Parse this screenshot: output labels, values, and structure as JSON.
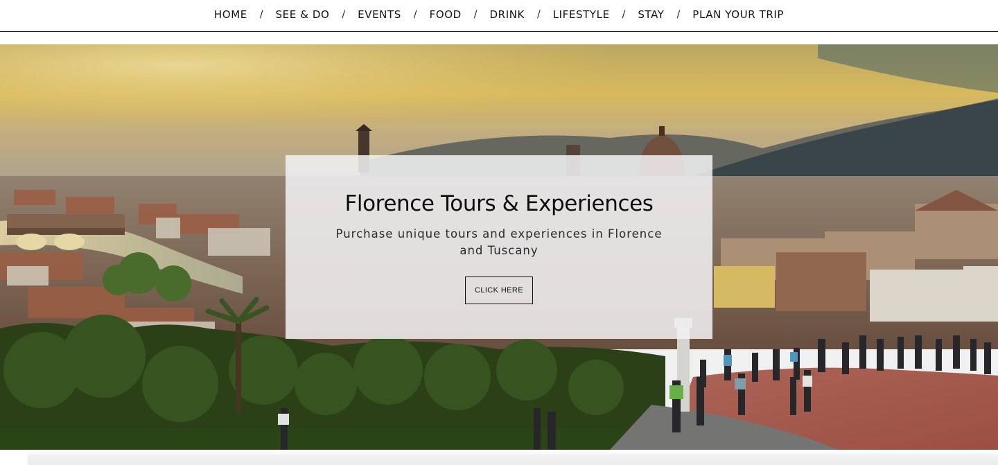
{
  "nav": {
    "items": [
      {
        "label": "HOME"
      },
      {
        "label": "SEE & DO"
      },
      {
        "label": "EVENTS"
      },
      {
        "label": "FOOD"
      },
      {
        "label": "DRINK"
      },
      {
        "label": "LIFESTYLE"
      },
      {
        "label": "STAY"
      },
      {
        "label": "PLAN YOUR TRIP"
      }
    ],
    "separator": "/"
  },
  "hero": {
    "title": "Florence Tours & Experiences",
    "subtitle": "Purchase unique tours and experiences in Florence and Tuscany",
    "button_label": "CLICK HERE",
    "image_subject": "Florence skyline at sunset from Piazzale Michelangelo",
    "colors": {
      "sky_top": "#c9a94a",
      "sky_glow": "#f2d36b",
      "hills": "#3d4a55",
      "terracotta": "#a0533a",
      "greenery": "#2f4a1c",
      "plaza": "#b5665a"
    }
  }
}
